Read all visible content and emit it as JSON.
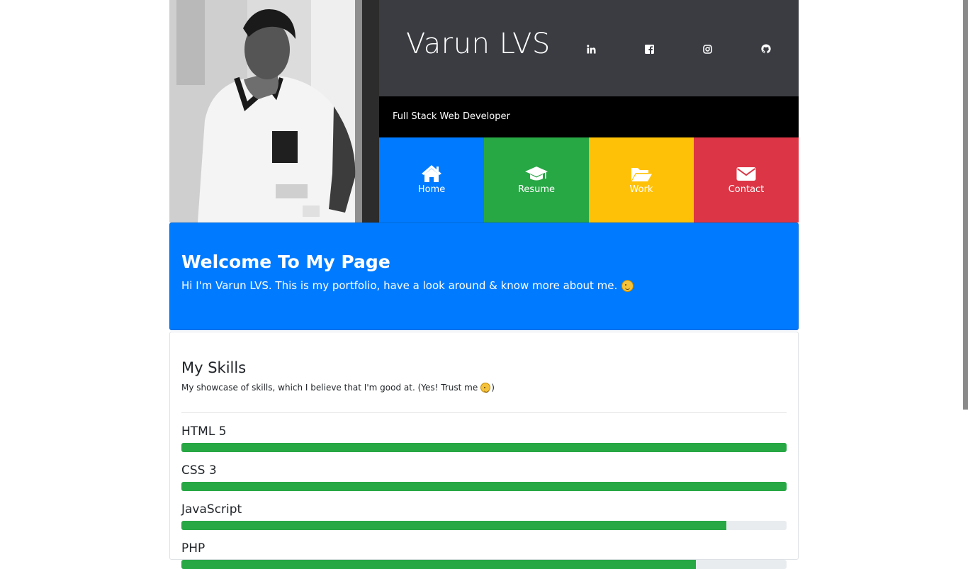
{
  "header": {
    "title": "Varun LVS",
    "subtitle": "Full Stack Web Developer",
    "social": [
      {
        "name": "linkedin-icon"
      },
      {
        "name": "facebook-icon"
      },
      {
        "name": "instagram-icon"
      },
      {
        "name": "github-icon"
      }
    ]
  },
  "nav": [
    {
      "label": "Home",
      "icon": "home-icon",
      "color": "#007bff"
    },
    {
      "label": "Resume",
      "icon": "graduation-cap-icon",
      "color": "#28a745"
    },
    {
      "label": "Work",
      "icon": "folder-open-icon",
      "color": "#ffc107"
    },
    {
      "label": "Contact",
      "icon": "envelope-icon",
      "color": "#dc3545"
    }
  ],
  "welcome": {
    "title": "Welcome To My Page",
    "text": "Hi I'm Varun LVS. This is my portfolio, have a look around & know more about me."
  },
  "skills": {
    "title": "My Skills",
    "description_before": "My showcase of skills, which I believe that I'm good at. (Yes! Trust me",
    "description_after": ")",
    "items": [
      {
        "name": "HTML 5",
        "level": 100
      },
      {
        "name": "CSS 3",
        "level": 100
      },
      {
        "name": "JavaScript",
        "level": 90
      },
      {
        "name": "PHP",
        "level": 85
      }
    ],
    "bar_color": "#28a745"
  }
}
